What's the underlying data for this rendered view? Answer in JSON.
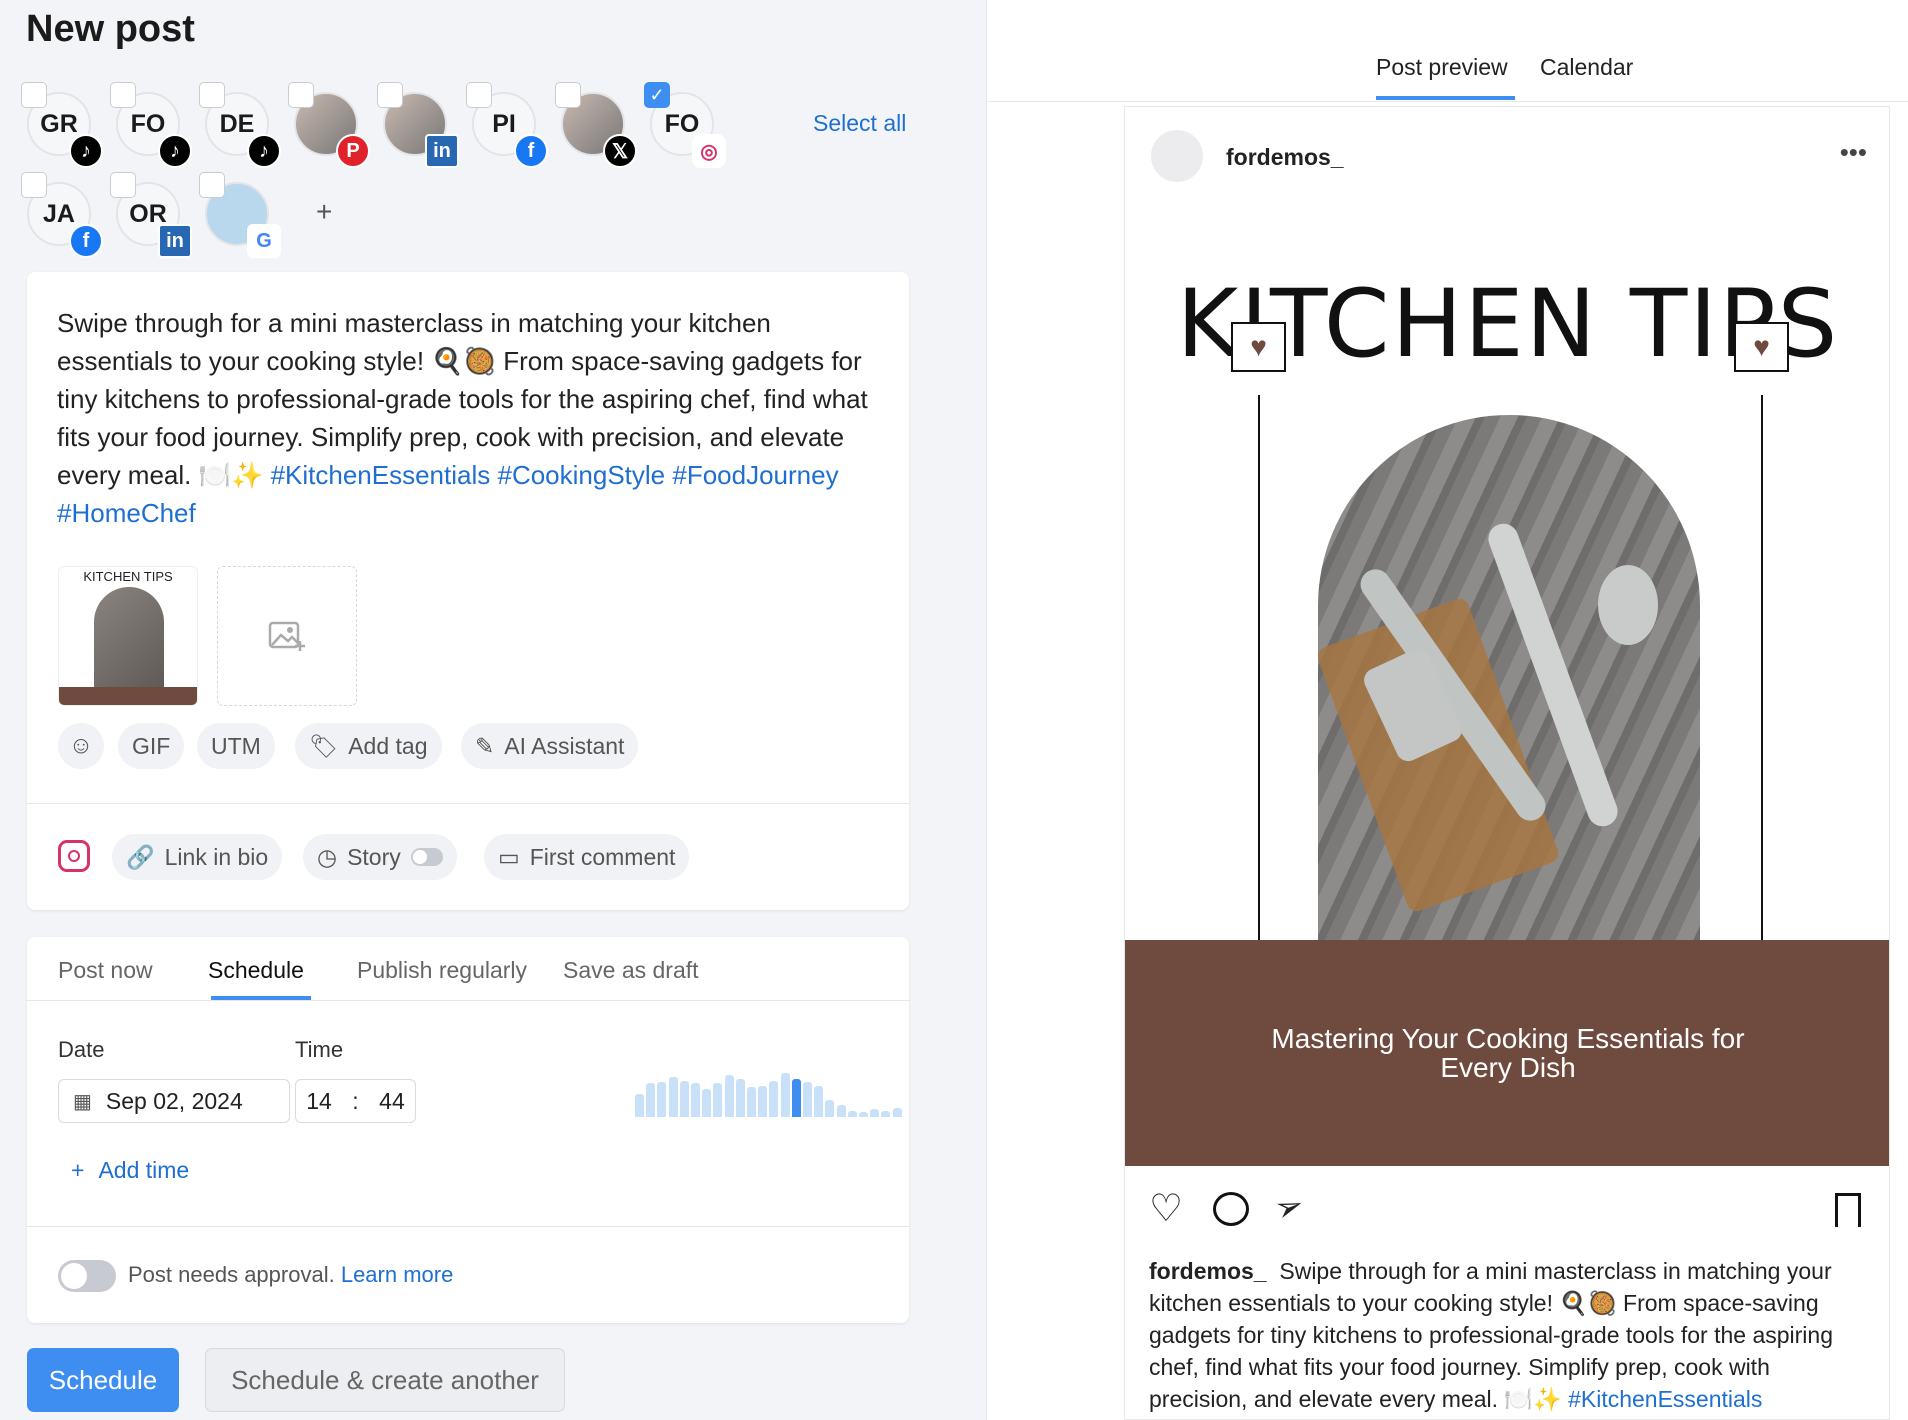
{
  "title": "New post",
  "accounts": [
    {
      "initials": "GR",
      "network": "tiktok",
      "checked": false
    },
    {
      "initials": "FO",
      "network": "tiktok",
      "checked": false
    },
    {
      "initials": "DE",
      "network": "tiktok",
      "checked": false
    },
    {
      "initials": "",
      "network": "pinterest",
      "checked": false
    },
    {
      "initials": "",
      "network": "linkedin",
      "checked": false
    },
    {
      "initials": "PI",
      "network": "facebook",
      "checked": false
    },
    {
      "initials": "",
      "network": "x",
      "checked": false
    },
    {
      "initials": "FO",
      "network": "instagram",
      "checked": true
    },
    {
      "initials": "JA",
      "network": "facebook",
      "checked": false
    },
    {
      "initials": "OR",
      "network": "linkedin",
      "checked": false
    },
    {
      "initials": "",
      "network": "google-business",
      "checked": false
    }
  ],
  "select_all": "Select all",
  "add_account": "+",
  "post": {
    "text": "Swipe through for a mini masterclass in matching your kitchen essentials to your cooking style! 🍳🥘 From space-saving gadgets for tiny kitchens to professional-grade tools for the aspiring chef, find what fits your food journey. Simplify prep, cook with precision, and elevate every meal. 🍽️✨ ",
    "hashtags": "#KitchenEssentials #CookingStyle #FoodJourney #HomeChef",
    "thumb_title": "KITCHEN TIPS"
  },
  "toolbar": {
    "gif": "GIF",
    "utm": "UTM",
    "add_tag": "Add tag",
    "ai": "AI Assistant"
  },
  "instagram_opts": {
    "link_in_bio": "Link in bio",
    "story": "Story",
    "story_on": false,
    "first_comment": "First comment"
  },
  "schedule_tabs": [
    "Post now",
    "Schedule",
    "Publish regularly",
    "Save as draft"
  ],
  "active_tab": "Schedule",
  "date_label": "Date",
  "time_label": "Time",
  "date": "Sep 02, 2024",
  "hour": "14",
  "minute": "44",
  "activity_bars": [
    68,
    101,
    104,
    119,
    107,
    101,
    83,
    101,
    125,
    113,
    89,
    92,
    107,
    131,
    113,
    104,
    92,
    50,
    35,
    17,
    14,
    23,
    17,
    26
  ],
  "activity_highlight": 14,
  "add_time": "Add time",
  "approval": {
    "text": "Post needs approval.",
    "link": "Learn more",
    "on": false
  },
  "buttons": {
    "schedule": "Schedule",
    "schedule_another": "Schedule & create another"
  },
  "preview_tabs": [
    "Post preview",
    "Calendar"
  ],
  "preview": {
    "username": "fordemos_",
    "headline": "KITCHEN TIPS",
    "band": "Mastering Your Cooking Essentials for Every Dish",
    "caption": "Swipe through for a mini masterclass in matching your kitchen essentials to your cooking style! 🍳🥘 From space-saving gadgets for tiny kitchens to professional-grade tools for the aspiring chef, find what fits your food journey. Simplify prep, cook with precision, and elevate every meal. 🍽️✨ ",
    "caption_tag": "#KitchenEssentials"
  },
  "colors": {
    "accent": "#3d8ef0",
    "link": "#1f6fd1",
    "band": "#6f4a3e"
  }
}
